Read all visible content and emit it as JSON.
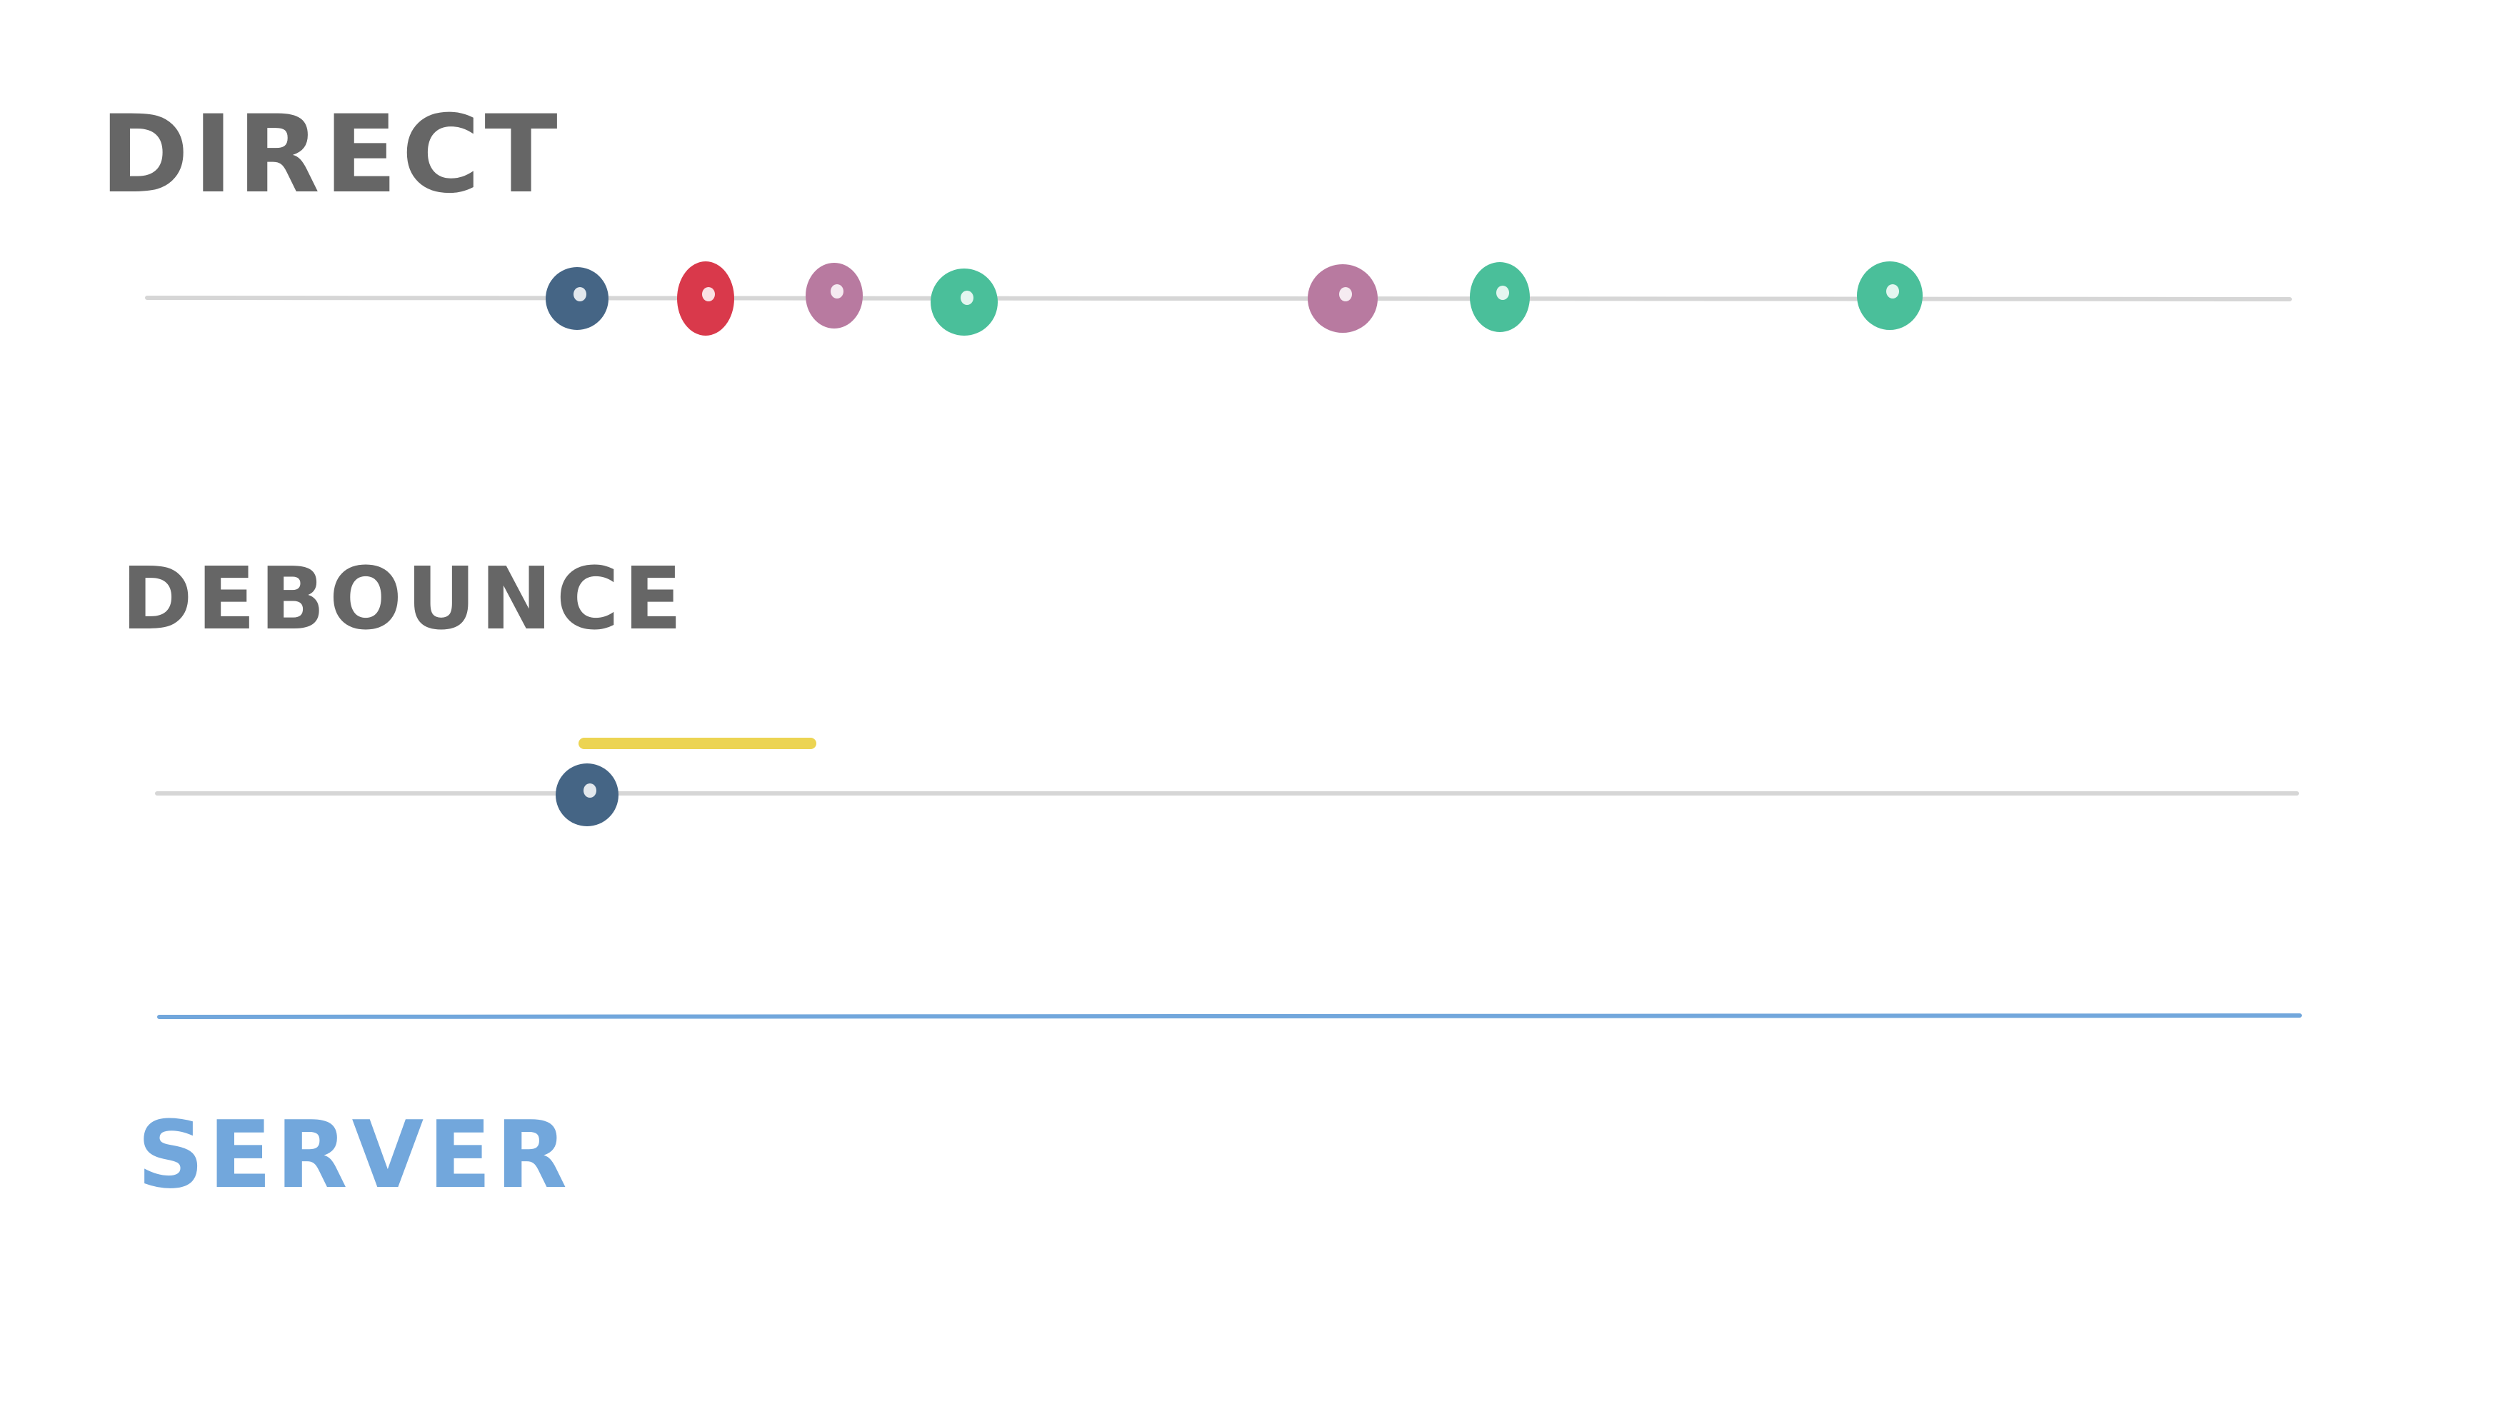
{
  "labels": {
    "direct": "DIRECT",
    "debounce": "DEBOUNCE",
    "server": "SERVER"
  },
  "colors": {
    "ink": "#666666",
    "track": "#d6d6d6",
    "server": "#72a7dc",
    "debounce_window": "#ecd452",
    "dot_blue": "#456585",
    "dot_red": "#d9394b",
    "dot_mauve": "#b87aa0",
    "dot_green": "#4abf9a"
  },
  "direct_events": [
    {
      "color": "dot_blue"
    },
    {
      "color": "dot_red"
    },
    {
      "color": "dot_mauve"
    },
    {
      "color": "dot_green"
    },
    {
      "color": "dot_mauve"
    },
    {
      "color": "dot_green"
    },
    {
      "color": "dot_green"
    }
  ],
  "debounce_events": [
    {
      "color": "dot_blue"
    }
  ]
}
